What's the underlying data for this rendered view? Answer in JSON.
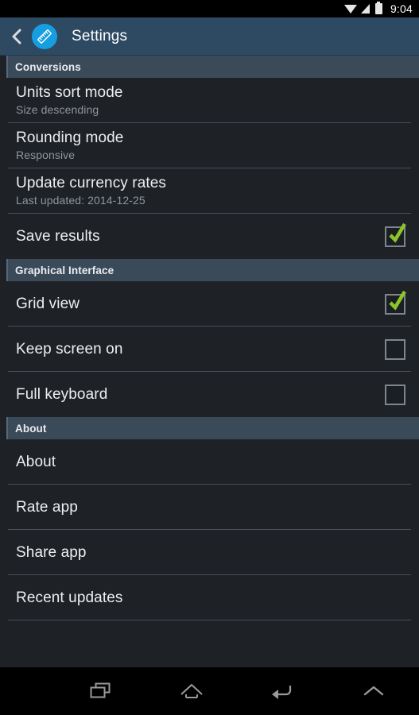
{
  "status_bar": {
    "time": "9:04",
    "icons": [
      "wifi-icon",
      "signal-icon",
      "battery-icon"
    ]
  },
  "action_bar": {
    "back_icon": "back-chevron-icon",
    "app_icon": "ruler-icon",
    "title": "Settings",
    "bg_color": "#2e4a63",
    "icon_color": "#159fe0"
  },
  "sections": [
    {
      "header": "Conversions",
      "items": [
        {
          "title": "Units sort mode",
          "summary": "Size descending",
          "type": "navigation"
        },
        {
          "title": "Rounding mode",
          "summary": "Responsive",
          "type": "navigation"
        },
        {
          "title": "Update currency rates",
          "summary": "Last updated: 2014-12-25",
          "type": "navigation"
        },
        {
          "title": "Save results",
          "summary": "",
          "type": "checkbox",
          "checked": true
        }
      ]
    },
    {
      "header": "Graphical Interface",
      "items": [
        {
          "title": "Grid view",
          "summary": "",
          "type": "checkbox",
          "checked": true
        },
        {
          "title": "Keep screen on",
          "summary": "",
          "type": "checkbox",
          "checked": false
        },
        {
          "title": "Full keyboard",
          "summary": "",
          "type": "checkbox",
          "checked": false
        }
      ]
    },
    {
      "header": "About",
      "items": [
        {
          "title": "About",
          "summary": "",
          "type": "navigation"
        },
        {
          "title": "Rate app",
          "summary": "",
          "type": "navigation"
        },
        {
          "title": "Share app",
          "summary": "",
          "type": "navigation"
        },
        {
          "title": "Recent updates",
          "summary": "",
          "type": "navigation"
        }
      ]
    }
  ],
  "colors": {
    "background": "#1e2227",
    "section_header": "#3b4a59",
    "divider": "#4a4f55",
    "checkbox_check": "#8bc528",
    "title_text": "#eceff2",
    "summary_text": "#8f959c"
  },
  "nav_bar": {
    "buttons": [
      {
        "name": "recents-icon",
        "label": "Recents"
      },
      {
        "name": "home-icon",
        "label": "Home"
      },
      {
        "name": "back-icon",
        "label": "Back"
      },
      {
        "name": "chevron-up-icon",
        "label": "Expand"
      }
    ]
  }
}
